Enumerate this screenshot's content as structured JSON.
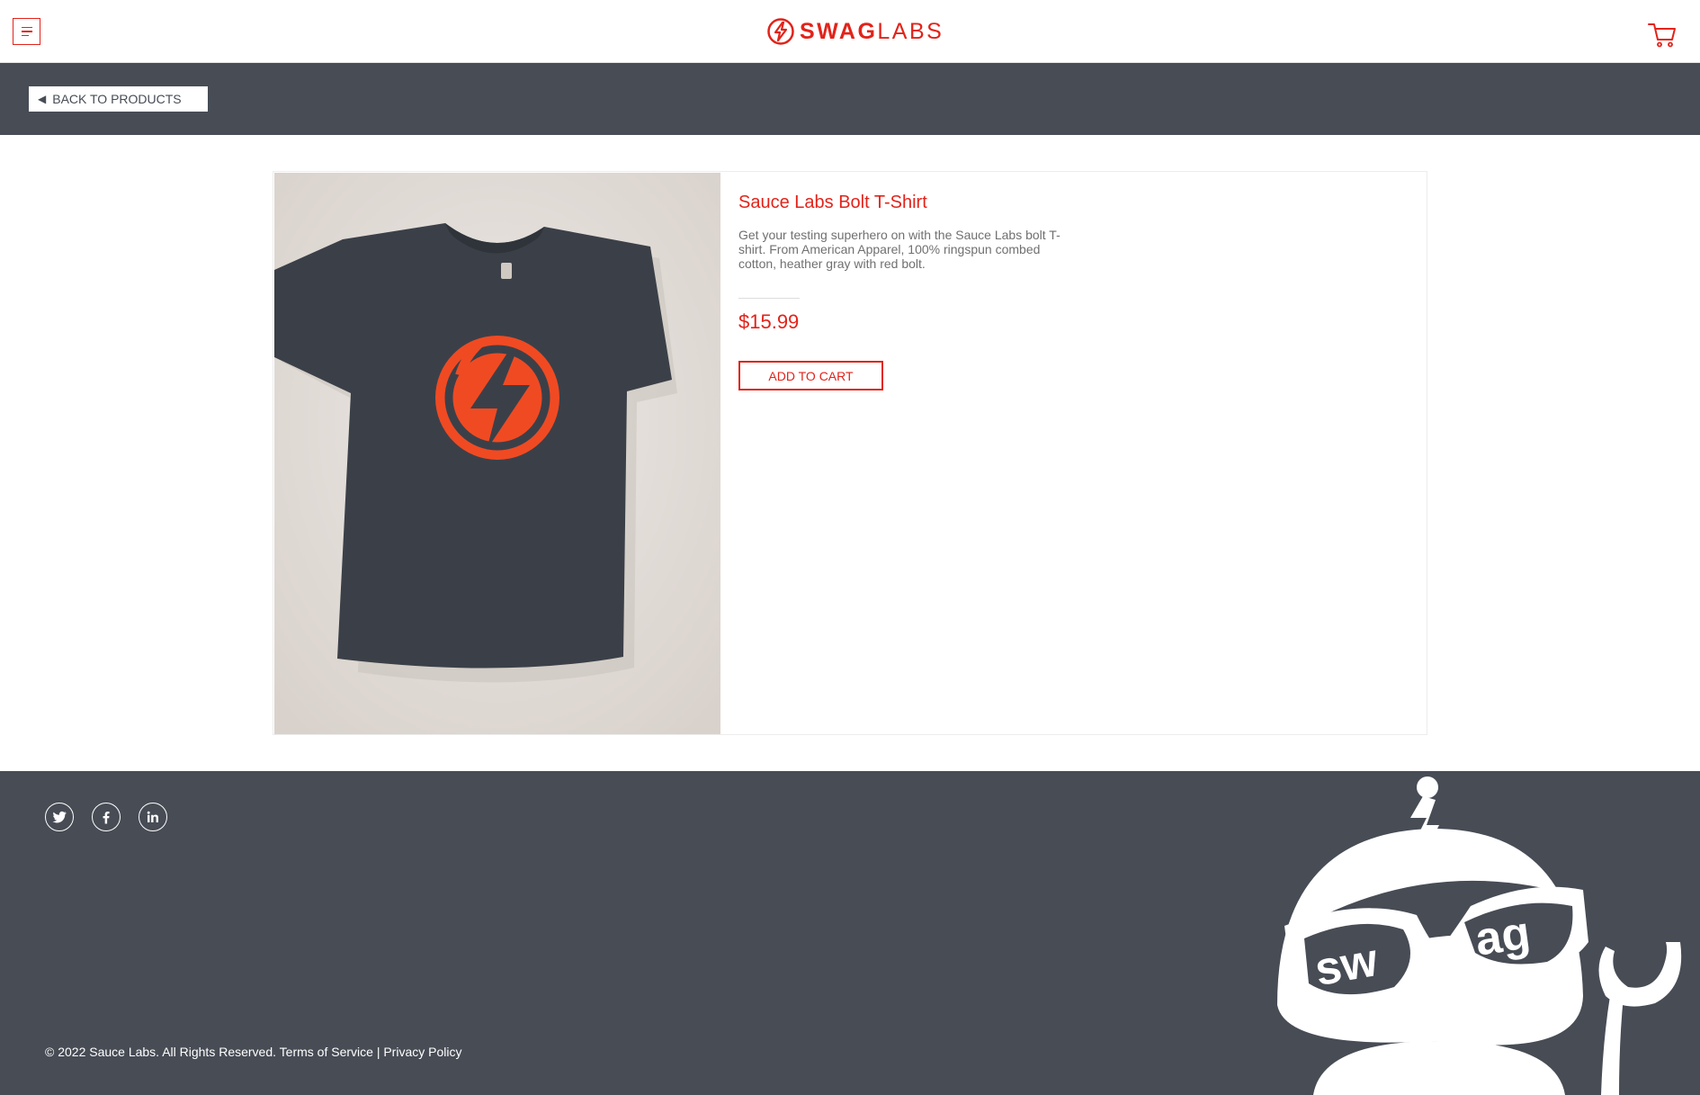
{
  "header": {
    "logo_bold": "SWAG",
    "logo_thin": "LABS",
    "menu_icon": "hamburger-menu-icon",
    "cart_icon": "shopping-cart-icon"
  },
  "subbar": {
    "back_label": "BACK TO PRODUCTS",
    "back_icon": "left-triangle-icon"
  },
  "product": {
    "name": "Sauce Labs Bolt T-Shirt",
    "description": "Get your testing superhero on with the Sauce Labs bolt T-shirt. From American Apparel, 100% ringspun combed cotton, heather gray with red bolt.",
    "price": "$15.99",
    "add_label": "ADD TO CART",
    "image_icon": "bolt-tshirt-image"
  },
  "footer": {
    "social": [
      "twitter-icon",
      "facebook-icon",
      "linkedin-icon"
    ],
    "copyright": "© 2022 Sauce Labs. All Rights Reserved.",
    "terms": "Terms of Service",
    "separator": "|",
    "privacy": "Privacy Policy",
    "mascot_text": "swag"
  },
  "colors": {
    "brand_red": "#e2231a",
    "dark_bar": "#474c55",
    "tshirt": "#3a3f46",
    "bolt_orange": "#f04a23"
  }
}
